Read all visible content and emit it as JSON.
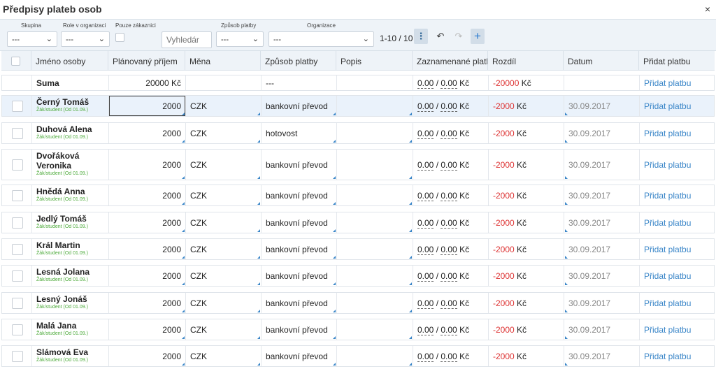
{
  "title": "Předpisy plateb osob",
  "close": "×",
  "filters": {
    "skupina": {
      "label": "Skupina",
      "value": "---"
    },
    "role": {
      "label": "Role v organizaci",
      "value": "---"
    },
    "pouze": {
      "label": "Pouze zákaznici"
    },
    "search_placeholder": "Vyhledár",
    "zpusob": {
      "label": "Způsob platby",
      "value": "---"
    },
    "organizace": {
      "label": "Organizace",
      "value": "---"
    }
  },
  "pager": "1-10 / 10",
  "columns": [
    "Jméno osoby",
    "Plánovaný příjem",
    "Měna",
    "Způsob platby",
    "Popis",
    "Zaznamenané platb",
    "Rozdíl",
    "Datum",
    "Přidat platbu"
  ],
  "sum_row": {
    "name": "Suma",
    "planned": "20000 Kč",
    "method": "---",
    "rec_a": "0.00",
    "rec_b": "0.00",
    "rec_unit": "Kč",
    "diff": "-20000",
    "diff_unit": "Kč",
    "add": "Přidat platbu"
  },
  "rows": [
    {
      "name": "Černý Tomáš",
      "role": "Žák/student (Od 01.09.)",
      "planned": "2000",
      "currency": "CZK",
      "method": "bankovní převod",
      "rec_a": "0.00",
      "rec_b": "0.00",
      "rec_unit": "Kč",
      "diff": "-2000",
      "diff_unit": "Kč",
      "date": "30.09.2017",
      "add": "Přidat platbu"
    },
    {
      "name": "Duhová Alena",
      "role": "Žák/student (Od 01.09.)",
      "planned": "2000",
      "currency": "CZK",
      "method": "hotovost",
      "rec_a": "0.00",
      "rec_b": "0.00",
      "rec_unit": "Kč",
      "diff": "-2000",
      "diff_unit": "Kč",
      "date": "30.09.2017",
      "add": "Přidat platbu"
    },
    {
      "name": "Dvořáková Veronika",
      "role": "Žák/student (Od 01.09.)",
      "planned": "2000",
      "currency": "CZK",
      "method": "bankovní převod",
      "rec_a": "0.00",
      "rec_b": "0.00",
      "rec_unit": "Kč",
      "diff": "-2000",
      "diff_unit": "Kč",
      "date": "30.09.2017",
      "add": "Přidat platbu"
    },
    {
      "name": "Hnědá Anna",
      "role": "Žák/student (Od 01.09.)",
      "planned": "2000",
      "currency": "CZK",
      "method": "bankovní převod",
      "rec_a": "0.00",
      "rec_b": "0.00",
      "rec_unit": "Kč",
      "diff": "-2000",
      "diff_unit": "Kč",
      "date": "30.09.2017",
      "add": "Přidat platbu"
    },
    {
      "name": "Jedlý Tomáš",
      "role": "Žák/student (Od 01.09.)",
      "planned": "2000",
      "currency": "CZK",
      "method": "bankovní převod",
      "rec_a": "0.00",
      "rec_b": "0.00",
      "rec_unit": "Kč",
      "diff": "-2000",
      "diff_unit": "Kč",
      "date": "30.09.2017",
      "add": "Přidat platbu"
    },
    {
      "name": "Král Martin",
      "role": "Žák/student (Od 01.09.)",
      "planned": "2000",
      "currency": "CZK",
      "method": "bankovní převod",
      "rec_a": "0.00",
      "rec_b": "0.00",
      "rec_unit": "Kč",
      "diff": "-2000",
      "diff_unit": "Kč",
      "date": "30.09.2017",
      "add": "Přidat platbu"
    },
    {
      "name": "Lesná Jolana",
      "role": "Žák/student (Od 01.09.)",
      "planned": "2000",
      "currency": "CZK",
      "method": "bankovní převod",
      "rec_a": "0.00",
      "rec_b": "0.00",
      "rec_unit": "Kč",
      "diff": "-2000",
      "diff_unit": "Kč",
      "date": "30.09.2017",
      "add": "Přidat platbu"
    },
    {
      "name": "Lesný Jonáš",
      "role": "Žák/student (Od 01.09.)",
      "planned": "2000",
      "currency": "CZK",
      "method": "bankovní převod",
      "rec_a": "0.00",
      "rec_b": "0.00",
      "rec_unit": "Kč",
      "diff": "-2000",
      "diff_unit": "Kč",
      "date": "30.09.2017",
      "add": "Přidat platbu"
    },
    {
      "name": "Malá Jana",
      "role": "Žák/student (Od 01.09.)",
      "planned": "2000",
      "currency": "CZK",
      "method": "bankovní převod",
      "rec_a": "0.00",
      "rec_b": "0.00",
      "rec_unit": "Kč",
      "diff": "-2000",
      "diff_unit": "Kč",
      "date": "30.09.2017",
      "add": "Přidat platbu"
    },
    {
      "name": "Slámová Eva",
      "role": "Žák/student (Od 01.09.)",
      "planned": "2000",
      "currency": "CZK",
      "method": "bankovní převod",
      "rec_a": "0.00",
      "rec_b": "0.00",
      "rec_unit": "Kč",
      "diff": "-2000",
      "diff_unit": "Kč",
      "date": "30.09.2017",
      "add": "Přidat platbu"
    }
  ],
  "icons": {
    "kebab": "kebab-icon",
    "undo": "undo-icon",
    "redo": "redo-icon",
    "add": "plus-icon",
    "chevron": "chevron-down-icon"
  }
}
